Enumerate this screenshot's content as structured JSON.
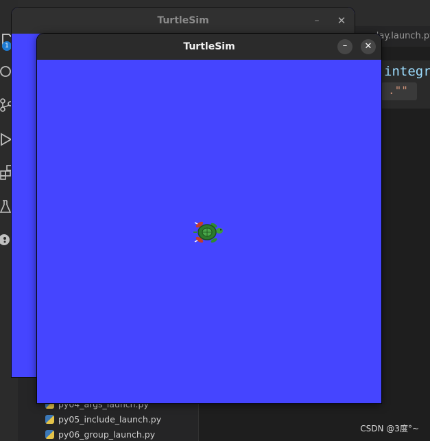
{
  "vscode": {
    "title_fragment": "件",
    "badge_count": "1",
    "tab_label": "_play.launch.py",
    "code_keyword": "integr",
    "code_string": ".\"\"",
    "explorer_files": [
      {
        "name": "py04_args_launch.py"
      },
      {
        "name": "py05_include_launch.py"
      },
      {
        "name": "py06_group_launch.py"
      }
    ],
    "icons": [
      "files-icon",
      "search-icon",
      "source-control-icon",
      "run-debug-icon",
      "extensions-icon",
      "testing-icon",
      "robot-icon"
    ]
  },
  "back_window": {
    "title": "TurtleSim",
    "minimize_label": "–",
    "close_label": "✕"
  },
  "front_window": {
    "title": "TurtleSim",
    "minimize_label": "–",
    "close_label": "✕",
    "background_color": "#4545ff"
  },
  "watermark": "CSDN @3度°~"
}
